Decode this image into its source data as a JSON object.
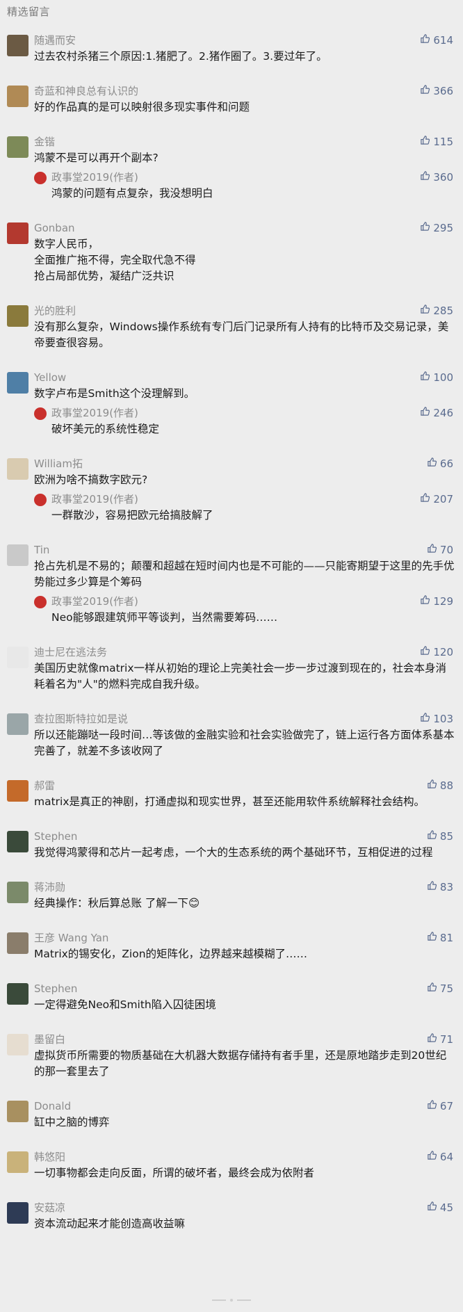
{
  "section_title": "精选留言",
  "author_suffix": "(作者)",
  "comments": [
    {
      "nick": "随遇而安",
      "text": "过去农村杀猪三个原因:1.猪肥了。2.猪作圈了。3.要过年了。",
      "likes": "614",
      "avatar_color": "#6b5a44",
      "reply": null
    },
    {
      "nick": "奇蓝和神良总有认识的",
      "text": "好的作品真的是可以映射很多现实事件和问题",
      "likes": "366",
      "avatar_color": "#b08a55",
      "reply": null
    },
    {
      "nick": "金锴",
      "text": "鸿蒙不是可以再开个副本?",
      "likes": "115",
      "avatar_color": "#7d8a58",
      "reply": {
        "nick": "政事堂2019",
        "text": "鸿蒙的问题有点复杂，我没想明白",
        "likes": "360"
      }
    },
    {
      "nick": "Gonban",
      "text": "数字人民币，\n全面推广拖不得，完全取代急不得\n抢占局部优势，凝结广泛共识",
      "likes": "295",
      "avatar_color": "#b3392f",
      "reply": null
    },
    {
      "nick": "光的胜利",
      "text": "没有那么复杂，Windows操作系统有专门后门记录所有人持有的比特币及交易记录，美帝要查很容易。",
      "likes": "285",
      "avatar_color": "#8a7a3c",
      "reply": null
    },
    {
      "nick": "Yellow",
      "text": "数字卢布是Smith这个没理解到。",
      "likes": "100",
      "avatar_color": "#4f7fa6",
      "reply": {
        "nick": "政事堂2019",
        "text": "破坏美元的系统性稳定",
        "likes": "246"
      }
    },
    {
      "nick": "William拓",
      "text": "欧洲为啥不搞数字欧元?",
      "likes": "66",
      "avatar_color": "#d9cbb0",
      "reply": {
        "nick": "政事堂2019",
        "text": "一群散沙，容易把欧元给搞肢解了",
        "likes": "207"
      }
    },
    {
      "nick": "Tin",
      "text": "抢占先机是不易的；颠覆和超越在短时间内也是不可能的——只能寄期望于这里的先手优势能过多少算是个筹码",
      "likes": "70",
      "avatar_color": "#c9c9c9",
      "reply": {
        "nick": "政事堂2019",
        "text": "Neo能够跟建筑师平等谈判，当然需要筹码……",
        "likes": "129"
      }
    },
    {
      "nick": "迪士尼在逃法务",
      "text": "美国历史就像matrix一样从初始的理论上完美社会一步一步过渡到现在的，社会本身消耗着名为\"人\"的燃料完成自我升级。",
      "likes": "120",
      "avatar_color": "#e8e8e8",
      "reply": null
    },
    {
      "nick": "查拉图斯特拉如是说",
      "text": "所以还能蹦哒一段时间…等该做的金融实验和社会实验做完了，链上运行各方面体系基本完善了，就差不多该收网了",
      "likes": "103",
      "avatar_color": "#9aa6a8",
      "reply": null
    },
    {
      "nick": "郝雷",
      "text": "matrix是真正的神剧，打通虚拟和现实世界，甚至还能用软件系统解释社会结构。",
      "likes": "88",
      "avatar_color": "#c46a2a",
      "reply": null
    },
    {
      "nick": "Stephen",
      "text": "我觉得鸿蒙得和芯片一起考虑，一个大的生态系统的两个基础环节，互相促进的过程",
      "likes": "85",
      "avatar_color": "#3a4a3a",
      "reply": null
    },
    {
      "nick": "蒋沛勋",
      "text": "经典操作：秋后算总账 了解一下😊",
      "likes": "83",
      "avatar_color": "#7b8a6a",
      "reply": null
    },
    {
      "nick": "王彦 Wang Yan",
      "text": "Matrix的锡安化，Zion的矩阵化，边界越来越模糊了……",
      "likes": "81",
      "avatar_color": "#8a7d6b",
      "reply": null
    },
    {
      "nick": "Stephen",
      "text": "一定得避免Neo和Smith陷入囚徒困境",
      "likes": "75",
      "avatar_color": "#3a4a3a",
      "reply": null
    },
    {
      "nick": "墨留白",
      "text": "虚拟货币所需要的物质基础在大机器大数据存储持有者手里，还是原地踏步走到20世纪的那一套里去了",
      "likes": "71",
      "avatar_color": "#e6ddd0",
      "reply": null
    },
    {
      "nick": "Donald",
      "text": "缸中之脑的博弈",
      "likes": "67",
      "avatar_color": "#a89060",
      "reply": null
    },
    {
      "nick": "韩悠阳",
      "text": "一切事物都会走向反面，所谓的破坏者，最终会成为依附者",
      "likes": "64",
      "avatar_color": "#c9b27a",
      "reply": null
    },
    {
      "nick": "安菇凉",
      "text": "资本流动起来才能创造高收益嘛",
      "likes": "45",
      "avatar_color": "#2e3b55",
      "reply": null
    }
  ]
}
